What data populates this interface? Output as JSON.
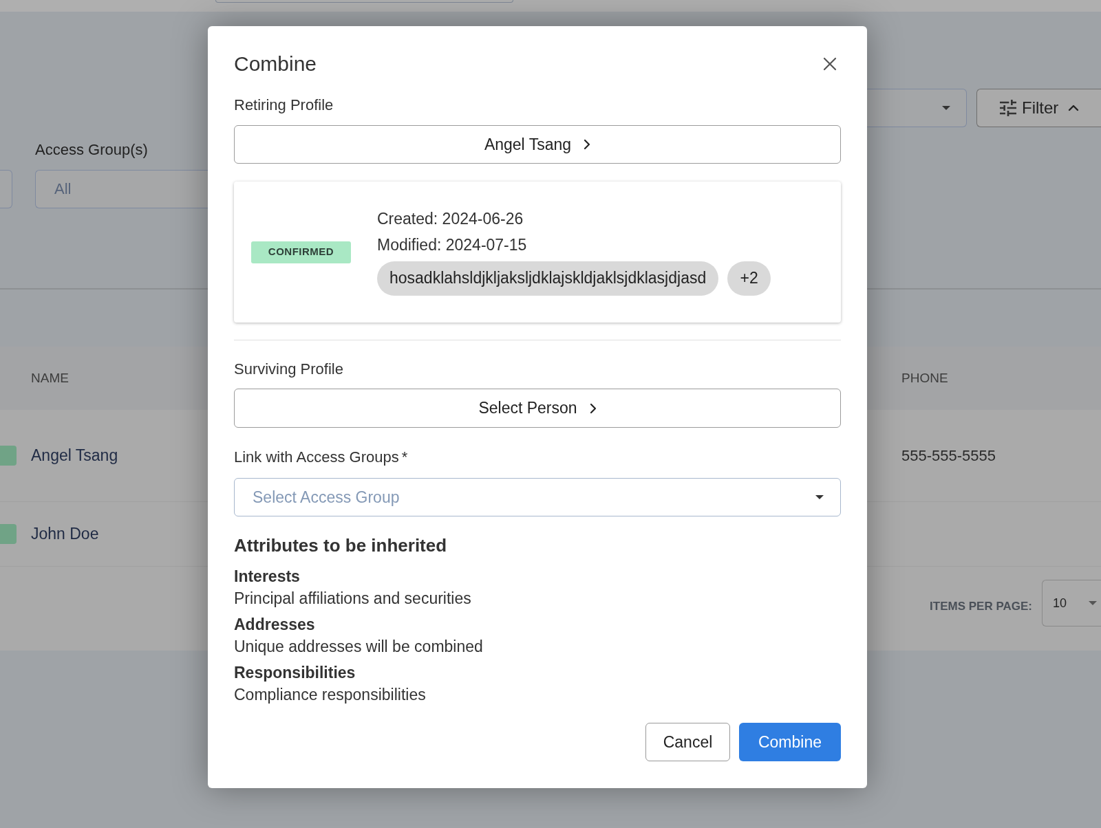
{
  "background": {
    "access_group_filter": {
      "label": "Access Group(s)",
      "placeholder": "All"
    },
    "filter_button": {
      "label": "Filter",
      "expanded": true
    },
    "table": {
      "columns": [
        "NAME",
        "PHONE"
      ],
      "rows": [
        {
          "name": "Angel Tsang",
          "phone": "555-555-5555"
        },
        {
          "name": "John Doe"
        }
      ]
    },
    "pagination": {
      "label": "ITEMS PER PAGE:",
      "page_size": "10"
    }
  },
  "dialog": {
    "title": "Combine",
    "retiring_profile": {
      "label": "Retiring Profile",
      "person": "Angel Tsang",
      "status": {
        "label": "CONFIRMED",
        "kind": "confirmed"
      },
      "created": "Created: 2024-06-26",
      "modified": "Modified: 2024-07-15",
      "tags": [
        "hosadklahsldjkljaksljdklajskldjaklsjdklasjdjasd"
      ],
      "more_tags": "+2"
    },
    "surviving_profile": {
      "label": "Surviving Profile",
      "person": "Select Person"
    },
    "access_groups": {
      "label": "Link with Access Groups",
      "required_mark": "*",
      "placeholder": "Select Access Group"
    },
    "attributes": {
      "title": "Attributes to be inherited",
      "items": [
        {
          "name": "Interests",
          "description": "Principal affiliations and securities"
        },
        {
          "name": "Addresses",
          "description": "Unique addresses will be combined"
        },
        {
          "name": "Responsibilities",
          "description": "Compliance responsibilities"
        }
      ]
    },
    "buttons": [
      {
        "label": "Cancel",
        "kind": "secondary"
      },
      {
        "label": "Combine",
        "kind": "primary"
      }
    ]
  }
}
